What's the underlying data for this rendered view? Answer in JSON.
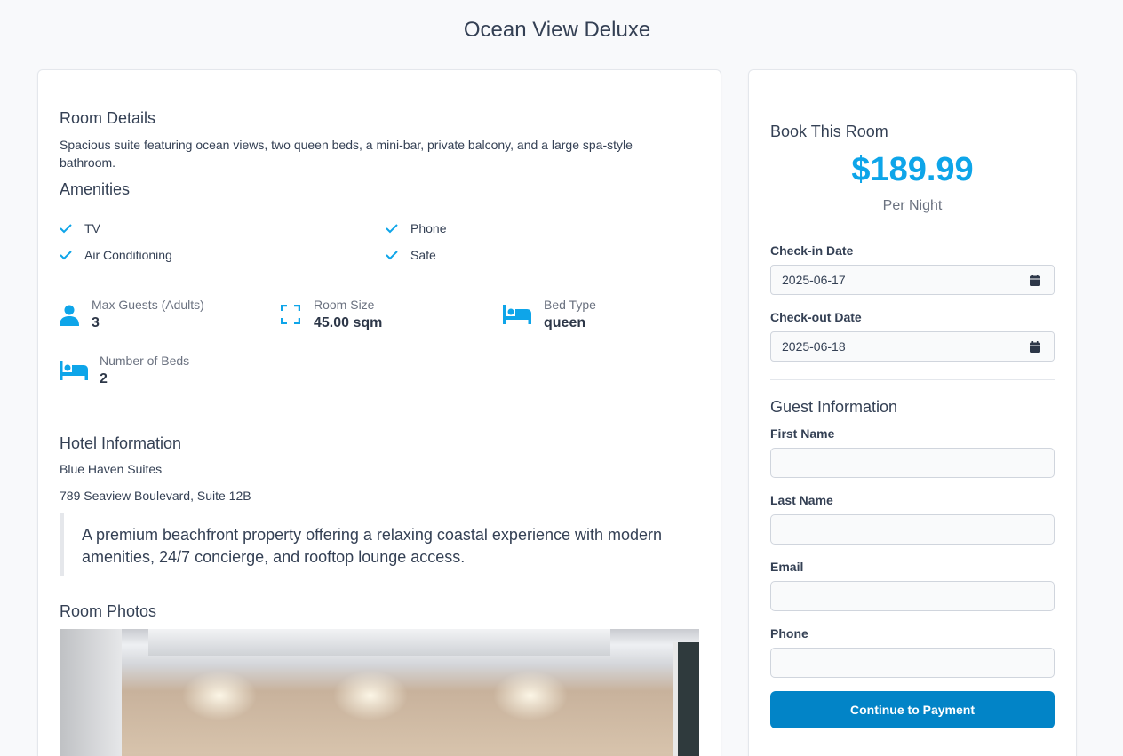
{
  "page": {
    "title": "Ocean View Deluxe"
  },
  "room_details": {
    "heading": "Room Details",
    "description": "Spacious suite featuring ocean views, two queen beds, a mini-bar, private balcony, and a large spa-style bathroom."
  },
  "amenities": {
    "heading": "Amenities",
    "items": [
      "TV",
      "Phone",
      "Air Conditioning",
      "Safe"
    ]
  },
  "stats": {
    "max_guests": {
      "label": "Max Guests (Adults)",
      "value": "3"
    },
    "room_size": {
      "label": "Room Size",
      "value": "45.00 sqm"
    },
    "bed_type": {
      "label": "Bed Type",
      "value": "queen"
    },
    "num_beds": {
      "label": "Number of Beds",
      "value": "2"
    }
  },
  "hotel": {
    "heading": "Hotel Information",
    "name": "Blue Haven Suites",
    "address": "789 Seaview Boulevard, Suite 12B",
    "description": "A premium beachfront property offering a relaxing coastal experience with modern amenities, 24/7 concierge, and rooftop lounge access."
  },
  "photos": {
    "heading": "Room Photos"
  },
  "booking": {
    "heading": "Book This Room",
    "price": "$189.99",
    "per_night": "Per Night",
    "checkin_label": "Check-in Date",
    "checkin_value": "2025-06-17",
    "checkout_label": "Check-out Date",
    "checkout_value": "2025-06-18"
  },
  "guest": {
    "heading": "Guest Information",
    "first_name_label": "First Name",
    "last_name_label": "Last Name",
    "email_label": "Email",
    "phone_label": "Phone",
    "submit_label": "Continue to Payment"
  },
  "colors": {
    "accent": "#0ea5e9",
    "button": "#0284c7"
  },
  "icons": {
    "check": "check-icon",
    "guests": "person-icon",
    "size": "expand-icon",
    "bed": "bed-icon",
    "calendar": "calendar-icon"
  }
}
